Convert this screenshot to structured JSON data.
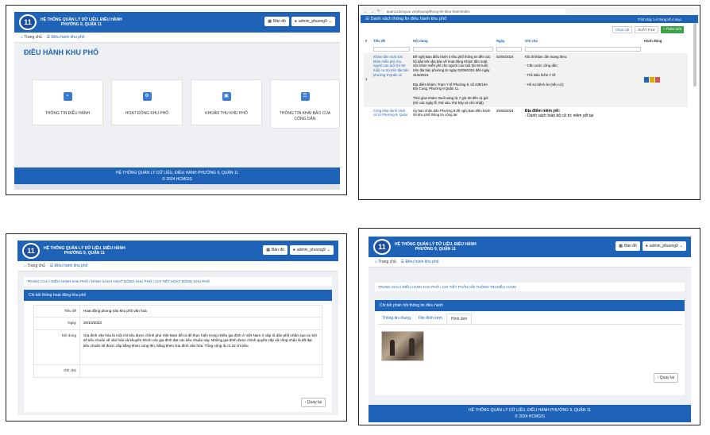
{
  "app": {
    "org_title_1": "HỆ THỐNG QUẢN LÝ DỮ LIỆU, ĐIỀU HÀNH",
    "org_title_2": "PHƯỜNG 9, QUẬN 11",
    "logo_text": "11",
    "map_button": "Bản đồ",
    "user": "admin_phuong9",
    "home": "Trang chủ",
    "nav_tab": "Điều hành khu phố",
    "footer_title": "HỆ THỐNG QUẢN LÝ DỮ LIỆU, ĐIỀU HÀNH PHƯỜNG 9, QUẬN 11",
    "footer_copy": "© 2024 HCMGIS"
  },
  "p1": {
    "heading": "ĐIỀU HÀNH KHU PHỐ",
    "cards": [
      {
        "label": "THÔNG TIN ĐIỀU HÀNH"
      },
      {
        "label": "HOẠT ĐỘNG KHU PHỐ"
      },
      {
        "label": "KHOẢN THU KHU PHỐ"
      },
      {
        "label": "THÔNG TIN KHAI BÁO CỦA CÔNG DÂN"
      }
    ]
  },
  "p2": {
    "url": "quan11dongvui.vn/phuong/thong-tin-dieu-hanh/index",
    "title": "Danh sách thông tin điều hành khu phố",
    "showing": "Trình bày 1-4 trong số 4 mục.",
    "btn_columns": "Chọn cột",
    "btn_export": "XUẤT FILE",
    "btn_add": "+ Thêm mới",
    "headers": {
      "num": "#",
      "title": "Tiêu đề",
      "content": "Nội dung",
      "date": "Ngày",
      "note": "Ghi chú",
      "action": "Hành động"
    },
    "rows": [
      {
        "num": "1",
        "title": "Khám tầm soát sức khỏe miễn phí cho người cao tuổi (từ 60 tuổi) cư trú trên địa bàn phường 9 Quận 11",
        "content_1": "Đề nghị Ban điều hành 4 khu phố thông tin đến các hộ dân trên địa bàn về hoạt động Khám tầm soát sức khỏe miễn phí cho người cao tuổi (từ 60 tuổi) trên địa bàn phường từ ngày 02/05/2024 đến ngày 31/5/2024.",
        "content_2": "Địa điểm khám: Trạm Y tế Phường 9, số 238/18A Đội Cung, Phường 9 Quận 11.",
        "content_3": "Thời gian khám: Buổi sáng từ 7 giờ 30 đến 11 giờ (trừ các ngày lễ, thứ sáu, thứ bảy và chủ nhật).",
        "date": "02/05/2024",
        "note_1": "Khi đi khám cần mang theo:",
        "note_2": "- Căn cước công dân;",
        "note_3": "- Thẻ Bảo hiểm Y tế;",
        "note_4": "- Hồ sơ bệnh án (nếu có);"
      },
      {
        "num": "",
        "title": "Công khai danh sách cử tri Phường 9, Quận",
        "content_1": "Ủy ban nhân dân Phường 9 đề nghị Ban điều hành 04 khu phố thông tin công tác",
        "content_2": "",
        "content_3": "",
        "date": "25/08/2024",
        "note_1": "Địa điểm niêm yết:",
        "note_2": "- Danh sách toàn bộ cử tri: niêm yết tại",
        "note_3": "",
        "note_4": ""
      }
    ]
  },
  "p3": {
    "breadcrumb": "TRANG CHỦ / ĐIỀU HÀNH KHU PHỐ / DANH SÁCH HOẠT ĐỘNG KHU PHỐ / CHI TIẾT HOẠT ĐỘNG KHU PHỐ",
    "box_title": "Chi tiết thông hoạt động khu phố",
    "rows": [
      {
        "key": "Tiêu đề",
        "value": "Hoạt động phong trào khu phố văn hoá"
      },
      {
        "key": "Ngày",
        "value": "20/10/2023"
      },
      {
        "key": "Nội dung",
        "value": "Gia đình văn hóa là một chỉ tiêu được chính phủ Việt Nam đề ra để thực hiện trong nhiều gia đình ở Việt Nam ở cấp tổ dân phố nhằm tạo ra một số tiêu chuẩn về văn hóa và khuyến khích các gia đình đạt các tiêu chuẩn này. Những gia đình được chính quyền cấp xã công nhận là đã đạt tiêu chuẩn sẽ được cấp bằng khen cùng tên, bằng khen Gia đình văn hóa. Tổng cộng là có 22 chỉ tiêu"
      },
      {
        "key": "Ghi chú",
        "value": ""
      }
    ],
    "back": "‹ Quay lại"
  },
  "p4": {
    "breadcrumb": "TRANG CHỦ / ĐIỀU HÀNH KHU PHỐ / CHI TIẾT PHẢN HỒI THÔNG TIN ĐIỀU HÀNH",
    "box_title": "Chi tiết phản hồi thông tin điều hành",
    "tabs": [
      {
        "label": "Thông tin chung"
      },
      {
        "label": "File đính kèm"
      },
      {
        "label": "Hình ảnh"
      }
    ],
    "back": "‹ Quay lại"
  }
}
